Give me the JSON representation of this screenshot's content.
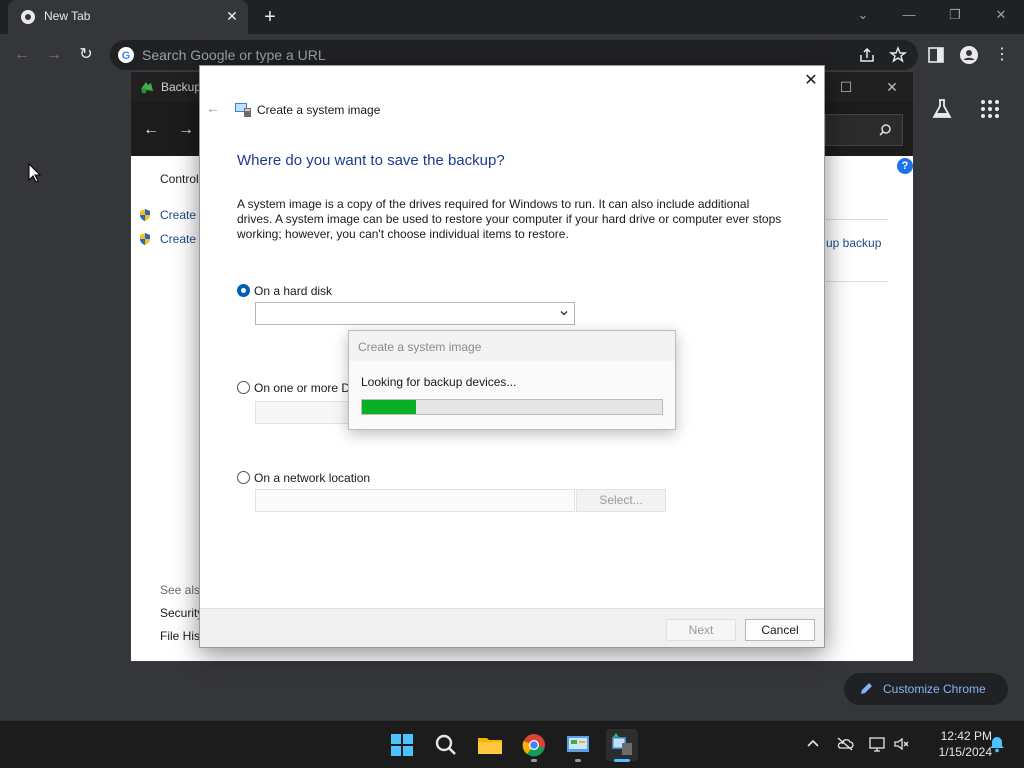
{
  "chrome": {
    "tab_title": "New Tab",
    "omnibox_placeholder": "Search Google or type a URL",
    "customize_label": "Customize Chrome"
  },
  "control_panel": {
    "window_title": "Backup",
    "left_nav": {
      "control_panel_home": "Control",
      "task_1": "Create a",
      "task_2": "Create a",
      "see_also": "See also",
      "security": "Security",
      "file_history": "File Hist"
    },
    "right_link": "up backup",
    "help_glyph": "?"
  },
  "wizard": {
    "title": "Create a system image",
    "heading": "Where do you want to save the backup?",
    "description": "A system image is a copy of the drives required for Windows to run. It can also include additional drives. A system image can be used to restore your computer if your hard drive or computer ever stops working; however, you can't choose individual items to restore.",
    "options": [
      {
        "label": "On a hard disk",
        "checked": true
      },
      {
        "label": "On one or more D",
        "checked": false
      },
      {
        "label": "On a network location",
        "checked": false
      }
    ],
    "select_button": "Select...",
    "next_button": "Next",
    "cancel_button": "Cancel"
  },
  "progress_dialog": {
    "title": "Create a system image",
    "message": "Looking for backup devices...",
    "progress_fraction": 0.18
  },
  "taskbar": {
    "apps": [
      "start-icon",
      "search-icon",
      "file-explorer-icon",
      "chrome-icon",
      "control-panel-icon",
      "backup-wizard-icon"
    ],
    "clock_time": "12:42 PM",
    "clock_date": "1/15/2024"
  },
  "colors": {
    "accent": "#005fb8",
    "heading_blue": "#1f3a93",
    "progress_green": "#06b025",
    "link_blue": "#1a4d8c",
    "chrome_link": "#8ab4f8"
  }
}
